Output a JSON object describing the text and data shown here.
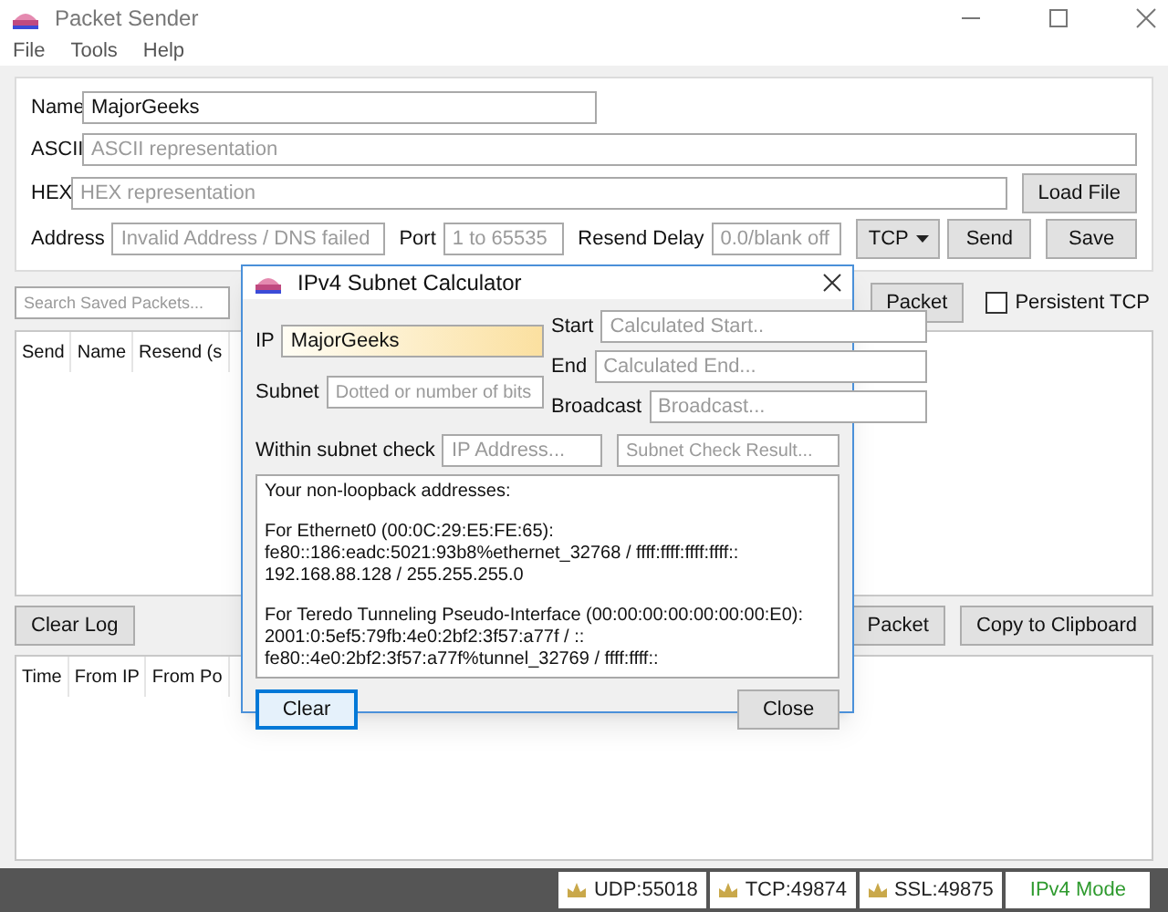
{
  "window": {
    "title": "Packet Sender"
  },
  "menu": [
    "File",
    "Tools",
    "Help"
  ],
  "packet_form": {
    "name": {
      "label": "Name",
      "value": "MajorGeeks"
    },
    "ascii": {
      "label": "ASCII",
      "placeholder": "ASCII representation"
    },
    "hex": {
      "label": "HEX",
      "placeholder": "HEX representation"
    },
    "load_file_button": "Load File",
    "address": {
      "label": "Address",
      "placeholder": "Invalid Address / DNS failed"
    },
    "port": {
      "label": "Port",
      "placeholder": "1 to 65535"
    },
    "resend_delay": {
      "label": "Resend Delay",
      "placeholder": "0.0/blank off"
    },
    "protocol": "TCP",
    "send_button": "Send",
    "save_button": "Save"
  },
  "saved_packets": {
    "search_placeholder": "Search Saved Packets...",
    "packet_button": "Packet",
    "persistent_tcp": {
      "label": "Persistent TCP",
      "checked": false
    },
    "columns": [
      "Send",
      "Name",
      "Resend (s"
    ]
  },
  "log": {
    "clear_button": "Clear Log",
    "packet_button": "Packet",
    "copy_button": "Copy to Clipboard",
    "columns": [
      "Time",
      "From IP",
      "From Po"
    ]
  },
  "status_bar": [
    {
      "kind": "port",
      "text": "UDP:55018"
    },
    {
      "kind": "port",
      "text": "TCP:49874"
    },
    {
      "kind": "port",
      "text": "SSL:49875"
    },
    {
      "kind": "mode",
      "text": "IPv4 Mode"
    }
  ],
  "dialog": {
    "title": "IPv4 Subnet Calculator",
    "ip": {
      "label": "IP",
      "value": "MajorGeeks",
      "highlighted": true
    },
    "subnet": {
      "label": "Subnet",
      "placeholder": "Dotted or number of bits"
    },
    "start": {
      "label": "Start",
      "placeholder": "Calculated Start.."
    },
    "end": {
      "label": "End",
      "placeholder": "Calculated End..."
    },
    "broadcast": {
      "label": "Broadcast",
      "placeholder": "Broadcast..."
    },
    "within_check": {
      "label": "Within subnet check",
      "ip_placeholder": "IP Address...",
      "result_placeholder": "Subnet Check Result..."
    },
    "output": [
      [
        "Your non-loopback addresses:"
      ],
      [
        "For Ethernet0 (00:0C:29:E5:FE:65):",
        "fe80::186:eadc:5021:93b8%ethernet_32768 / ffff:ffff:ffff:ffff::",
        "192.168.88.128 / 255.255.255.0"
      ],
      [
        "For Teredo Tunneling Pseudo-Interface (00:00:00:00:00:00:00:E0):",
        "2001:0:5ef5:79fb:4e0:2bf2:3f57:a77f / ::",
        "fe80::4e0:2bf2:3f57:a77f%tunnel_32769 / ffff:ffff::"
      ]
    ],
    "buttons": [
      {
        "label": "Clear",
        "focused": true
      },
      {
        "label": "Close",
        "focused": false
      }
    ]
  }
}
